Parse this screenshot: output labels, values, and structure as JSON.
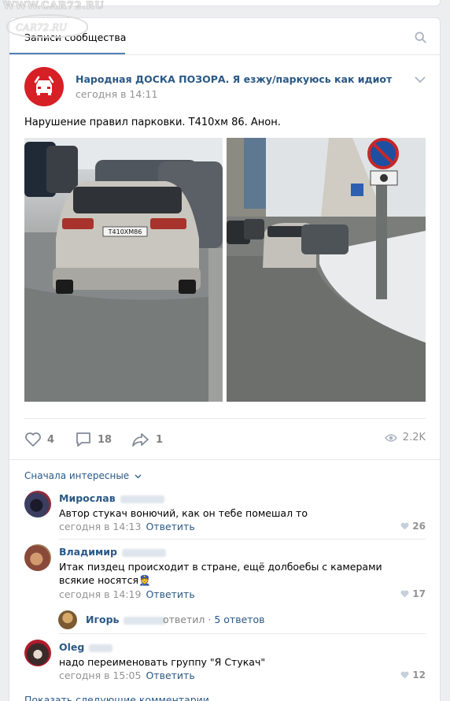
{
  "watermark": {
    "site": "WWW.CAR72.RU",
    "logo": "CAR72.RU"
  },
  "tabs": {
    "active": "Записи сообщества"
  },
  "post": {
    "group_name": "Народная ДОСКА ПОЗОРА. Я езжу/паркуюсь как идиот",
    "time": "сегодня в 14:11",
    "text": "Нарушение правил парковки. Т410хм 86. Анон.",
    "plate_text": "Т410ХМ86",
    "likes": "4",
    "comments": "18",
    "shares": "1",
    "views": "2.2K"
  },
  "comments_section": {
    "sort_label": "Сначала интересные",
    "comments": [
      {
        "name": "Мирослав",
        "text": "Автор стукач вонючий, как он тебе помешал то",
        "time": "сегодня в 14:13",
        "reply": "Ответить",
        "likes": "26"
      },
      {
        "name": "Владимир",
        "text": "Итак пиздец происходит в стране, ещё долбоебы с камерами всякие носятся👮",
        "time": "сегодня в 14:19",
        "reply": "Ответить",
        "likes": "17"
      },
      {
        "name": "Oleg",
        "text": "надо переименовать группу \"Я Стукач\"",
        "time": "сегодня в 15:05",
        "reply": "Ответить",
        "likes": "12"
      }
    ],
    "thread": {
      "name": "Игорь",
      "verb": "ответил",
      "sep": "·",
      "answers": "5 ответов"
    },
    "show_more": "Показать следующие комментарии"
  },
  "colors": {
    "link": "#2a5885",
    "accent": "#5181b8",
    "avatar_red": "#d71f26",
    "muted": "#939393"
  }
}
